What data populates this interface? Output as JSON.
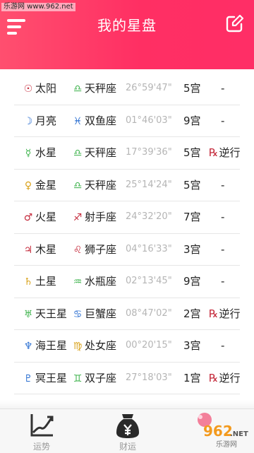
{
  "watermark": "乐游网 www.962.net",
  "header": {
    "title": "我的星盘",
    "menu_icon": "menu-icon",
    "edit_icon": "edit-icon",
    "color": "#ff3366"
  },
  "rows": [
    {
      "planet_glyph": "☉",
      "planet": "太阳",
      "glyph_color": "#c4293a",
      "sign_glyph": "♎",
      "sign": "天秤座",
      "sign_color": "#3bb24a",
      "degree": "26°59'47\"",
      "house": "5宫",
      "retro": "-",
      "is_retro": false
    },
    {
      "planet_glyph": "☽",
      "planet": "月亮",
      "glyph_color": "#2b6fd1",
      "sign_glyph": "♓",
      "sign": "双鱼座",
      "sign_color": "#2b6fd1",
      "degree": "01°46'03\"",
      "house": "9宫",
      "retro": "-",
      "is_retro": false
    },
    {
      "planet_glyph": "☿",
      "planet": "水星",
      "glyph_color": "#3bb24a",
      "sign_glyph": "♎",
      "sign": "天秤座",
      "sign_color": "#3bb24a",
      "degree": "17°39'36\"",
      "house": "5宫",
      "retro": "逆行",
      "is_retro": true
    },
    {
      "planet_glyph": "♀",
      "planet": "金星",
      "glyph_color": "#d9a21b",
      "sign_glyph": "♎",
      "sign": "天秤座",
      "sign_color": "#3bb24a",
      "degree": "25°14'24\"",
      "house": "5宫",
      "retro": "-",
      "is_retro": false
    },
    {
      "planet_glyph": "♂",
      "planet": "火星",
      "glyph_color": "#c4293a",
      "sign_glyph": "♐",
      "sign": "射手座",
      "sign_color": "#c4293a",
      "degree": "24°32'20\"",
      "house": "7宫",
      "retro": "-",
      "is_retro": false
    },
    {
      "planet_glyph": "♃",
      "planet": "木星",
      "glyph_color": "#c4293a",
      "sign_glyph": "♌",
      "sign": "狮子座",
      "sign_color": "#c4293a",
      "degree": "04°16'33\"",
      "house": "3宫",
      "retro": "-",
      "is_retro": false
    },
    {
      "planet_glyph": "♄",
      "planet": "土星",
      "glyph_color": "#d9a21b",
      "sign_glyph": "♒",
      "sign": "水瓶座",
      "sign_color": "#3bb24a",
      "degree": "02°13'45\"",
      "house": "9宫",
      "retro": "-",
      "is_retro": false
    },
    {
      "planet_glyph": "♅",
      "planet": "天王星",
      "glyph_color": "#3bb24a",
      "sign_glyph": "♋",
      "sign": "巨蟹座",
      "sign_color": "#2b6fd1",
      "degree": "08°47'02\"",
      "house": "2宫",
      "retro": "逆行",
      "is_retro": true
    },
    {
      "planet_glyph": "♆",
      "planet": "海王星",
      "glyph_color": "#2b6fd1",
      "sign_glyph": "♍",
      "sign": "处女座",
      "sign_color": "#d9a21b",
      "degree": "00°20'15\"",
      "house": "3宫",
      "retro": "-",
      "is_retro": false
    },
    {
      "planet_glyph": "♇",
      "planet": "冥王星",
      "glyph_color": "#2b6fd1",
      "sign_glyph": "♊",
      "sign": "双子座",
      "sign_color": "#3bb24a",
      "degree": "27°18'03\"",
      "house": "1宫",
      "retro": "逆行",
      "is_retro": true
    }
  ],
  "retro_glyph": "℞",
  "tabs": [
    {
      "label": "运势",
      "icon": "chart-line-icon"
    },
    {
      "label": "财运",
      "icon": "money-bag-icon"
    }
  ],
  "brand": "962.NET 乐游网"
}
